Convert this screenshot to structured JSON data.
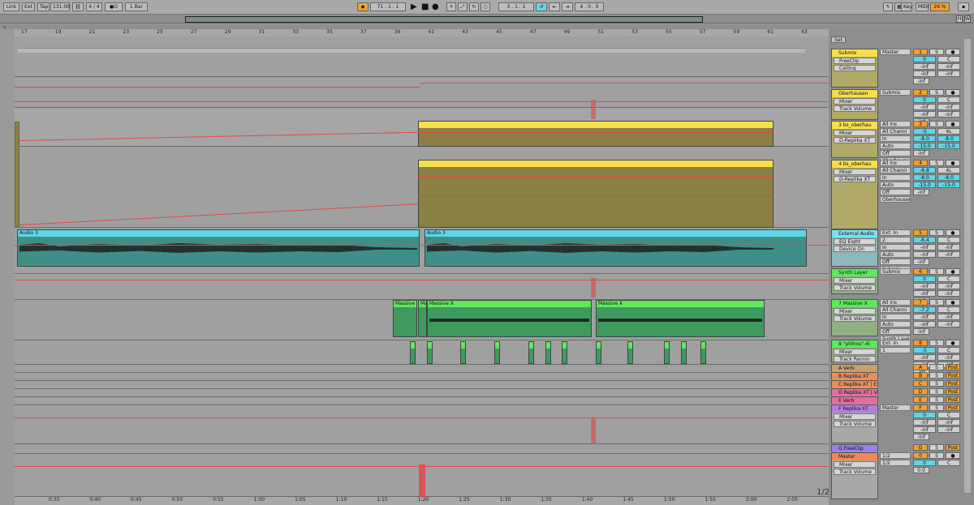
{
  "transport": {
    "link": "Link",
    "ext": "Ext",
    "tap": "Tap",
    "tempo": "131.00",
    "signature": "4 / 4",
    "metro": "●O",
    "quant": "1 Bar",
    "position": "71 .   1 .   1",
    "loop_start": "3 .   1 .   1",
    "loop_len": "4 .   0 .   0",
    "key": "Key",
    "midi": "MIDI",
    "cpu": "26 %",
    "h": "H",
    "w": "W"
  },
  "ruler": {
    "bars": [
      "17",
      "19",
      "21",
      "23",
      "25",
      "27",
      "29",
      "31",
      "33",
      "35",
      "37",
      "39",
      "41",
      "43",
      "45",
      "47",
      "49",
      "51",
      "53",
      "55",
      "57",
      "59",
      "61",
      "63"
    ],
    "times": [
      "0:35",
      "0:40",
      "0:45",
      "0:50",
      "0:55",
      "1:00",
      "1:05",
      "1:10",
      "1:15",
      "1:20",
      "1:25",
      "1:30",
      "1:35",
      "1:40",
      "1:45",
      "1:50",
      "1:55",
      "2:00",
      "2:05"
    ]
  },
  "page_indicator": "1/2",
  "set_label": "Set",
  "clips": {
    "audio_a": "Audio 3",
    "audio_b": "Audio 3",
    "massive_a": "Massive X",
    "massive_b": "Ma",
    "massive_c": "Massive X",
    "massive_d": "Massive X"
  },
  "tracks": [
    {
      "name": "Submix",
      "color": "#f5e04a",
      "devices": [
        "FreeClip",
        "Ceiling"
      ],
      "io": [
        "Master"
      ],
      "num": "1",
      "vol": "0",
      "pan": "C",
      "sends": [
        "-inf",
        "-inf",
        "-inf",
        "-inf"
      ],
      "extra": "-inf"
    },
    {
      "name": "Oberhausen",
      "color": "#f5e04a",
      "devices": [
        "Mixer",
        "Track Volume"
      ],
      "io": [
        "Submix"
      ],
      "num": "2",
      "vol": "0",
      "pan": "C",
      "sends": [
        "-inf",
        "-inf",
        "-inf",
        "-inf"
      ],
      "extra": "-inf"
    },
    {
      "name": "3 bs_oberhau",
      "color": "#f5e04a",
      "devices": [
        "Mixer",
        "D-Replika XT"
      ],
      "io": [
        "All Ins",
        "All Channi",
        "In",
        "Auto",
        "Off",
        "Oberhausen"
      ],
      "num": "3",
      "vol": "-5",
      "pan": "4L",
      "sends": [
        "-8.0",
        "-8.0",
        "-15.0",
        "-15.0"
      ],
      "extra": "-inf"
    },
    {
      "name": "4 bs_oberhau",
      "color": "#f5e04a",
      "devices": [
        "Mixer",
        "D-Replika XT"
      ],
      "io": [
        "All Ins",
        "All Channi",
        "In",
        "Auto",
        "Off",
        "Oberhausen"
      ],
      "num": "4",
      "vol": "-6.8",
      "pan": "4L",
      "sends": [
        "-8.0",
        "-8.0",
        "-15.0",
        "-15.0"
      ],
      "extra": "-inf"
    },
    {
      "name": "External Audio",
      "color": "#7ee2ee",
      "devices": [
        "EQ Eight",
        "Device On"
      ],
      "io": [
        "Ext. In",
        "2",
        "In",
        "Auto",
        "Off",
        "Submix"
      ],
      "num": "5",
      "vol": "-6.4",
      "pan": "C",
      "sends": [
        "-inf",
        "-inf",
        "-inf",
        "-inf"
      ],
      "extra": "-inf"
    },
    {
      "name": "Synth Layer",
      "color": "#5ee85e",
      "devices": [
        "Mixer",
        "Track Volume"
      ],
      "io": [
        "Submix"
      ],
      "num": "6",
      "vol": "0",
      "pan": "C",
      "sends": [
        "-inf",
        "-inf",
        "-inf",
        "-inf"
      ],
      "extra": "-inf"
    },
    {
      "name": "7 Massive X",
      "color": "#5ee85e",
      "devices": [
        "Mixer",
        "Track Volume"
      ],
      "io": [
        "All Ins",
        "All Channi",
        "In",
        "Auto",
        "Off",
        "Synth Layer"
      ],
      "num": "7",
      "vol": "-7.2",
      "pan": "C",
      "sends": [
        "-inf",
        "-inf",
        "-inf",
        "-inf"
      ],
      "extra": "-inf"
    },
    {
      "name": "8 \"phlnos\"-4i",
      "color": "#5ee85e",
      "devices": [
        "Mixer",
        "Track Pannin"
      ],
      "io": [
        "Ext. In",
        "1"
      ],
      "num": "8",
      "vol": "-5",
      "pan": "C",
      "sends": [
        "-inf",
        "-inf",
        "-inf",
        "-inf"
      ],
      "extra": "-inf"
    },
    {
      "name": "A Verb",
      "color": "#c8a070",
      "devices": [],
      "io": [],
      "num": "A",
      "vol": "",
      "pan": "",
      "sends": [],
      "extra": "",
      "post": "Post"
    },
    {
      "name": "B Replika XT",
      "color": "#e89060",
      "devices": [],
      "io": [],
      "num": "B",
      "post": "Post"
    },
    {
      "name": "C Replika XT | E",
      "color": "#e89060",
      "devices": [],
      "io": [],
      "num": "C",
      "post": "Post"
    },
    {
      "name": "D Replika XT | V",
      "color": "#e070a0",
      "devices": [],
      "io": [],
      "num": "D",
      "post": "Post"
    },
    {
      "name": "E Verb",
      "color": "#e070a0",
      "devices": [],
      "io": [],
      "num": "E",
      "post": "Post"
    },
    {
      "name": "F Replika XT",
      "color": "#b080e0",
      "devices": [
        "Mixer",
        "Track Volume"
      ],
      "io": [
        "Master"
      ],
      "num": "F",
      "vol": "0",
      "pan": "C",
      "sends": [
        "-inf",
        "-inf",
        "-inf",
        "-inf"
      ],
      "extra": "-inf",
      "post": "Post"
    },
    {
      "name": "G FreeClip",
      "color": "#9a80e8",
      "devices": [],
      "io": [],
      "num": "G",
      "post": "Post"
    },
    {
      "name": "Master",
      "color": "#f08a50",
      "devices": [
        "Mixer",
        "Track Volume"
      ],
      "io": [
        "1/2",
        "1/2"
      ],
      "num": "0",
      "vol": "0",
      "pan": "C",
      "extra": "0.0"
    }
  ],
  "colors": {
    "yellow": "#f5e04a",
    "cyan": "#5fd6e8",
    "green": "#5ee85e",
    "orange": "#f0a030",
    "red": "#e04848",
    "olive": "#8a7f45",
    "teal": "#3f8f86"
  }
}
